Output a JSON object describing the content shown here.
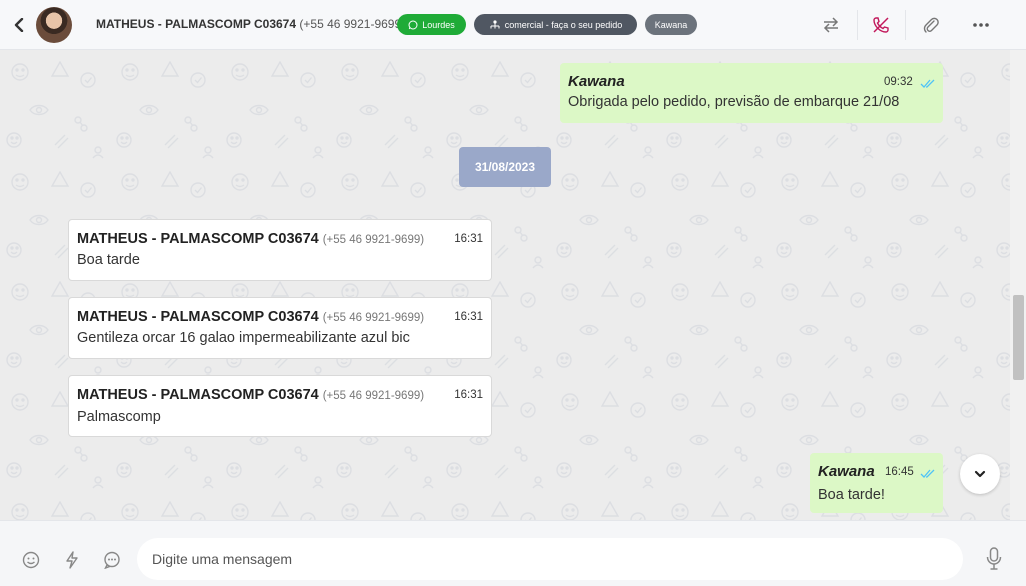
{
  "header": {
    "contact_name": "MATHEUS - PALMASCOMP C03674",
    "contact_phone": "(+55 46 9921-9699)",
    "tags": {
      "whatsapp_agent": "Lourdes",
      "department": "comercial - faça o seu pedido",
      "user": "Kawana"
    },
    "icons": [
      "chevron-left-icon",
      "transfer-icon",
      "phone-off-icon",
      "paperclip-icon",
      "more-horizontal-icon"
    ]
  },
  "chat": {
    "messages_top": [
      {
        "sender": "Kawana",
        "time": "09:32",
        "text": "Obrigada pelo pedido, previsão de embarque 21/08"
      }
    ],
    "date_separator": "31/08/2023",
    "incoming": [
      {
        "sender": "MATHEUS - PALMASCOMP C03674",
        "phone": "(+55 46 9921-9699)",
        "time": "16:31",
        "text": "Boa tarde"
      },
      {
        "sender": "MATHEUS - PALMASCOMP C03674",
        "phone": "(+55 46 9921-9699)",
        "time": "16:31",
        "text": "Gentileza orcar 16 galao impermeabilizante azul bic"
      },
      {
        "sender": "MATHEUS - PALMASCOMP C03674",
        "phone": "(+55 46 9921-9699)",
        "time": "16:31",
        "text": "Palmascomp"
      }
    ],
    "last_outgoing": {
      "sender": "Kawana",
      "time": "16:45",
      "text": "Boa tarde!"
    }
  },
  "footer": {
    "input_placeholder": "Digite uma mensagem",
    "icons": [
      "emoji-icon",
      "lightning-icon",
      "chat-bubble-icon",
      "microphone-icon"
    ]
  },
  "colors": {
    "outgoing_bubble": "#dcf8c6",
    "incoming_bubble": "#ffffff",
    "chat_background": "#ececec",
    "tag_green": "#1fab37",
    "tag_dark": "#505762",
    "tag_gray": "#6c737c",
    "date_pill": "#9aa8c9",
    "read_ticks": "#4fc3f7",
    "phone_off": "#c2185b"
  }
}
